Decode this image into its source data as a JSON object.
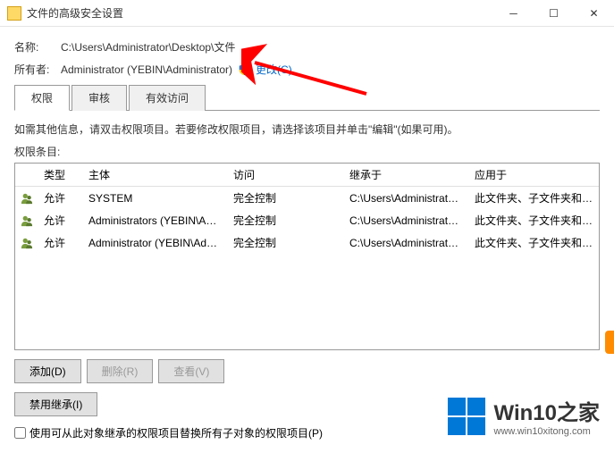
{
  "titlebar": {
    "title": "文件的高级安全设置"
  },
  "name_label": "名称:",
  "name_value": "C:\\Users\\Administrator\\Desktop\\文件",
  "owner_label": "所有者:",
  "owner_value": "Administrator (YEBIN\\Administrator)",
  "change_link": "更改(C)",
  "tabs": {
    "permissions": "权限",
    "audit": "审核",
    "effective": "有效访问"
  },
  "hint": "如需其他信息，请双击权限项目。若要修改权限项目，请选择该项目并单击\"编辑\"(如果可用)。",
  "list_label": "权限条目:",
  "columns": {
    "type": "类型",
    "principal": "主体",
    "access": "访问",
    "inherited": "继承于",
    "applies": "应用于"
  },
  "entries": [
    {
      "type": "允许",
      "principal": "SYSTEM",
      "access": "完全控制",
      "inherited": "C:\\Users\\Administrator\\D...",
      "applies": "此文件夹、子文件夹和文件"
    },
    {
      "type": "允许",
      "principal": "Administrators (YEBIN\\Administr...",
      "access": "完全控制",
      "inherited": "C:\\Users\\Administrator\\D...",
      "applies": "此文件夹、子文件夹和文件"
    },
    {
      "type": "允许",
      "principal": "Administrator (YEBIN\\Administrat...",
      "access": "完全控制",
      "inherited": "C:\\Users\\Administrator\\D...",
      "applies": "此文件夹、子文件夹和文件"
    }
  ],
  "buttons": {
    "add": "添加(D)",
    "remove": "删除(R)",
    "view": "查看(V)",
    "disable_inherit": "禁用继承(I)"
  },
  "replace_checkbox": "使用可从此对象继承的权限项目替换所有子对象的权限项目(P)",
  "watermark": {
    "title": "Win10之家",
    "url": "www.win10xitong.com"
  }
}
